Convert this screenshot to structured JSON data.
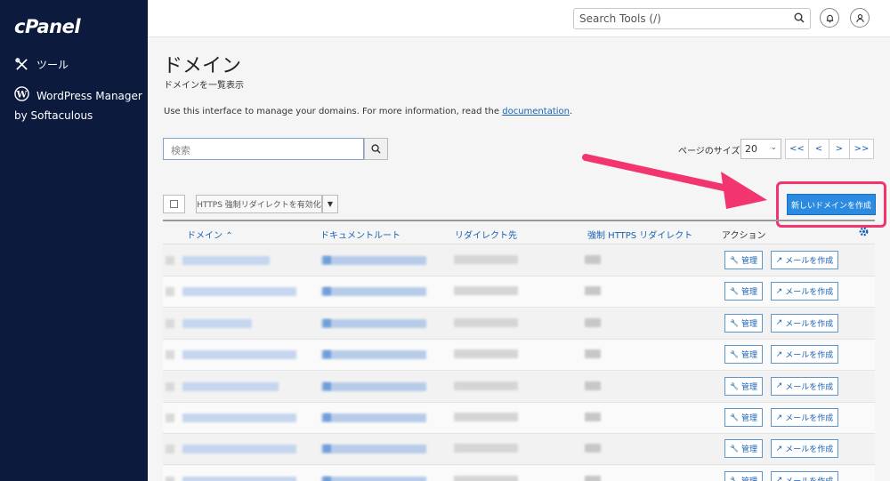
{
  "sidebar": {
    "logo": "cPanel",
    "items": [
      {
        "label": "ツール",
        "icon": "tools-icon"
      },
      {
        "label": "WordPress Manager",
        "sub": "by Softaculous",
        "icon": "wordpress-icon"
      }
    ]
  },
  "topbar": {
    "search_placeholder": "Search Tools (/)"
  },
  "page": {
    "title": "ドメイン",
    "subtitle": "ドメインを一覧表示",
    "intro_text": "Use this interface to manage your domains. For more information, read the ",
    "intro_link": "documentation",
    "intro_end": "."
  },
  "search": {
    "placeholder": "検索"
  },
  "pagination": {
    "page_size_label": "ページのサイズ",
    "page_size": "20",
    "first": "<<",
    "prev": "<",
    "next": ">",
    "last": ">>"
  },
  "bulk": {
    "https_redirect_label": "HTTPS 強制リダイレクトを有効化"
  },
  "new_domain_label": "新しいドメインを作成",
  "table": {
    "headers": {
      "domain": "ドメイン",
      "doc_root": "ドキュメントルート",
      "redirect": "リダイレクト先",
      "https_redirect": "強制 HTTPS リダイレクト",
      "actions": "アクション"
    },
    "row_actions": {
      "manage": "管理",
      "create_email": "メールを作成"
    },
    "row_count": 8
  },
  "colors": {
    "sidebar_bg": "#0b1a3d",
    "accent": "#2a8be0",
    "link": "#1a62b5",
    "highlight": "#f2356f"
  }
}
